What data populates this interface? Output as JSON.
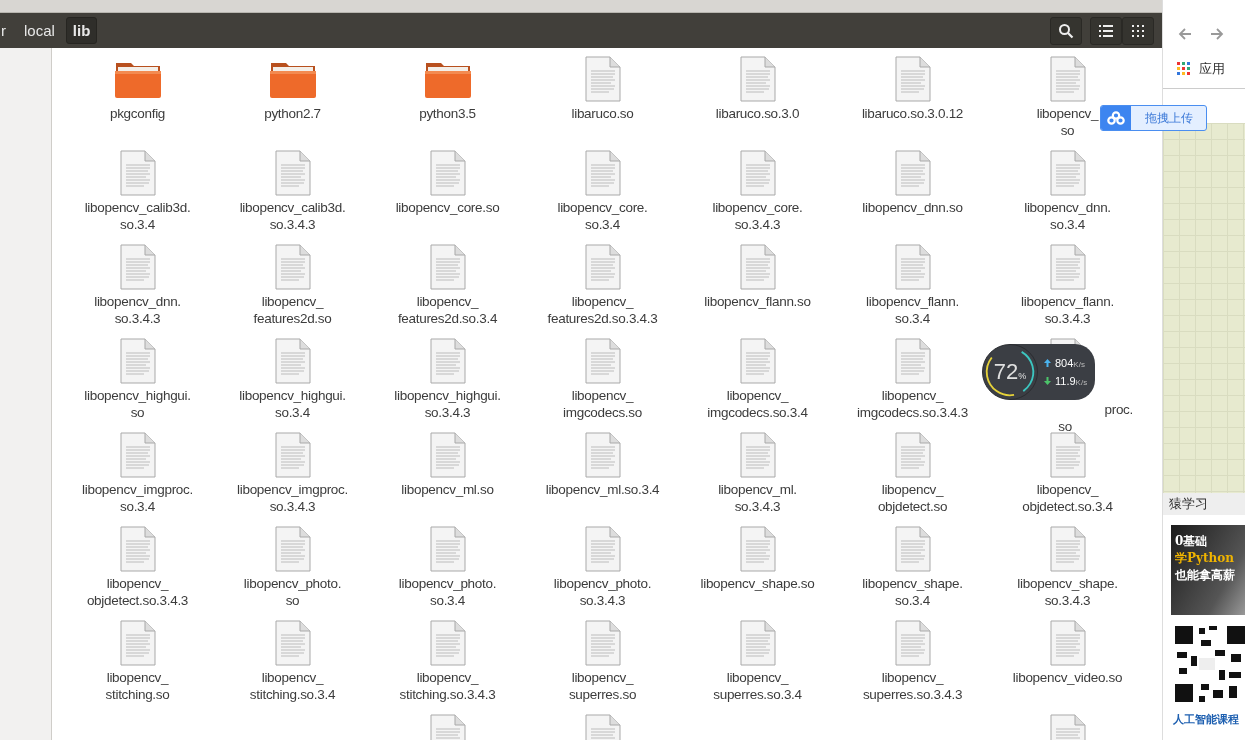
{
  "path_bar": [
    {
      "label": "r",
      "selected": false
    },
    {
      "label": "local",
      "selected": false
    },
    {
      "label": "lib",
      "selected": true
    }
  ],
  "files": [
    {
      "kind": "folder",
      "lines": [
        "pkgconfig"
      ]
    },
    {
      "kind": "folder",
      "lines": [
        "python2.7"
      ]
    },
    {
      "kind": "folder",
      "lines": [
        "python3.5"
      ]
    },
    {
      "kind": "file",
      "lines": [
        "libaruco.so"
      ]
    },
    {
      "kind": "file",
      "lines": [
        "libaruco.so.3.0"
      ]
    },
    {
      "kind": "file",
      "lines": [
        "libaruco.so.3.0.12"
      ]
    },
    {
      "kind": "file",
      "lines": [
        "libopencv_",
        "so"
      ]
    },
    {
      "kind": "file",
      "lines": [
        "libopencv_calib3d.",
        "so.3.4"
      ]
    },
    {
      "kind": "file",
      "lines": [
        "libopencv_calib3d.",
        "so.3.4.3"
      ]
    },
    {
      "kind": "file",
      "lines": [
        "libopencv_core.so"
      ]
    },
    {
      "kind": "file",
      "lines": [
        "libopencv_core.",
        "so.3.4"
      ]
    },
    {
      "kind": "file",
      "lines": [
        "libopencv_core.",
        "so.3.4.3"
      ]
    },
    {
      "kind": "file",
      "lines": [
        "libopencv_dnn.so"
      ]
    },
    {
      "kind": "file",
      "lines": [
        "libopencv_dnn.",
        "so.3.4"
      ]
    },
    {
      "kind": "file",
      "lines": [
        "libopencv_dnn.",
        "so.3.4.3"
      ]
    },
    {
      "kind": "file",
      "lines": [
        "libopencv_",
        "features2d.so"
      ]
    },
    {
      "kind": "file",
      "lines": [
        "libopencv_",
        "features2d.so.3.4"
      ]
    },
    {
      "kind": "file",
      "lines": [
        "libopencv_",
        "features2d.so.3.4.3"
      ]
    },
    {
      "kind": "file",
      "lines": [
        "libopencv_flann.so"
      ]
    },
    {
      "kind": "file",
      "lines": [
        "libopencv_flann.",
        "so.3.4"
      ]
    },
    {
      "kind": "file",
      "lines": [
        "libopencv_flann.",
        "so.3.4.3"
      ]
    },
    {
      "kind": "file",
      "lines": [
        "libopencv_highgui.",
        "so"
      ]
    },
    {
      "kind": "file",
      "lines": [
        "libopencv_highgui.",
        "so.3.4"
      ]
    },
    {
      "kind": "file",
      "lines": [
        "libopencv_highgui.",
        "so.3.4.3"
      ]
    },
    {
      "kind": "file",
      "lines": [
        "libopencv_",
        "imgcodecs.so"
      ]
    },
    {
      "kind": "file",
      "lines": [
        "libopencv_",
        "imgcodecs.so.3.4"
      ]
    },
    {
      "kind": "file",
      "lines": [
        "libopencv_",
        "imgcodecs.so.3.4.3"
      ]
    },
    {
      "kind": "file",
      "lines": [
        "proc.",
        "so"
      ]
    },
    {
      "kind": "file",
      "lines": [
        "libopencv_imgproc.",
        "so.3.4"
      ]
    },
    {
      "kind": "file",
      "lines": [
        "libopencv_imgproc.",
        "so.3.4.3"
      ]
    },
    {
      "kind": "file",
      "lines": [
        "libopencv_ml.so"
      ]
    },
    {
      "kind": "file",
      "lines": [
        "libopencv_ml.so.3.4"
      ]
    },
    {
      "kind": "file",
      "lines": [
        "libopencv_ml.",
        "so.3.4.3"
      ]
    },
    {
      "kind": "file",
      "lines": [
        "libopencv_",
        "objdetect.so"
      ]
    },
    {
      "kind": "file",
      "lines": [
        "libopencv_",
        "objdetect.so.3.4"
      ]
    },
    {
      "kind": "file",
      "lines": [
        "libopencv_",
        "objdetect.so.3.4.3"
      ]
    },
    {
      "kind": "file",
      "lines": [
        "libopencv_photo.",
        "so"
      ]
    },
    {
      "kind": "file",
      "lines": [
        "libopencv_photo.",
        "so.3.4"
      ]
    },
    {
      "kind": "file",
      "lines": [
        "libopencv_photo.",
        "so.3.4.3"
      ]
    },
    {
      "kind": "file",
      "lines": [
        "libopencv_shape.so"
      ]
    },
    {
      "kind": "file",
      "lines": [
        "libopencv_shape.",
        "so.3.4"
      ]
    },
    {
      "kind": "file",
      "lines": [
        "libopencv_shape.",
        "so.3.4.3"
      ]
    },
    {
      "kind": "file",
      "lines": [
        "libopencv_",
        "stitching.so"
      ]
    },
    {
      "kind": "file",
      "lines": [
        "libopencv_",
        "stitching.so.3.4"
      ]
    },
    {
      "kind": "file",
      "lines": [
        "libopencv_",
        "stitching.so.3.4.3"
      ]
    },
    {
      "kind": "file",
      "lines": [
        "libopencv_",
        "superres.so"
      ]
    },
    {
      "kind": "file",
      "lines": [
        "libopencv_",
        "superres.so.3.4"
      ]
    },
    {
      "kind": "file",
      "lines": [
        "libopencv_",
        "superres.so.3.4.3"
      ]
    },
    {
      "kind": "file",
      "lines": [
        "libopencv_video.so"
      ]
    },
    {
      "kind": "blank"
    },
    {
      "kind": "blank"
    },
    {
      "kind": "file"
    },
    {
      "kind": "file"
    },
    {
      "kind": "blank"
    },
    {
      "kind": "blank"
    },
    {
      "kind": "file"
    }
  ],
  "net_monitor": {
    "percent": "72",
    "percent_unit": "%",
    "upload": "804",
    "upload_unit": "K/s",
    "download": "11.9",
    "download_unit": "K/s"
  },
  "upload_badge": {
    "label": "拖拽上传"
  },
  "browser": {
    "bookmark": "应用",
    "section_title": "猿学习",
    "ad": {
      "line1": "0基础",
      "line2": "学Python",
      "line3": "也能拿高薪"
    },
    "course_title": "人工智能课程"
  }
}
